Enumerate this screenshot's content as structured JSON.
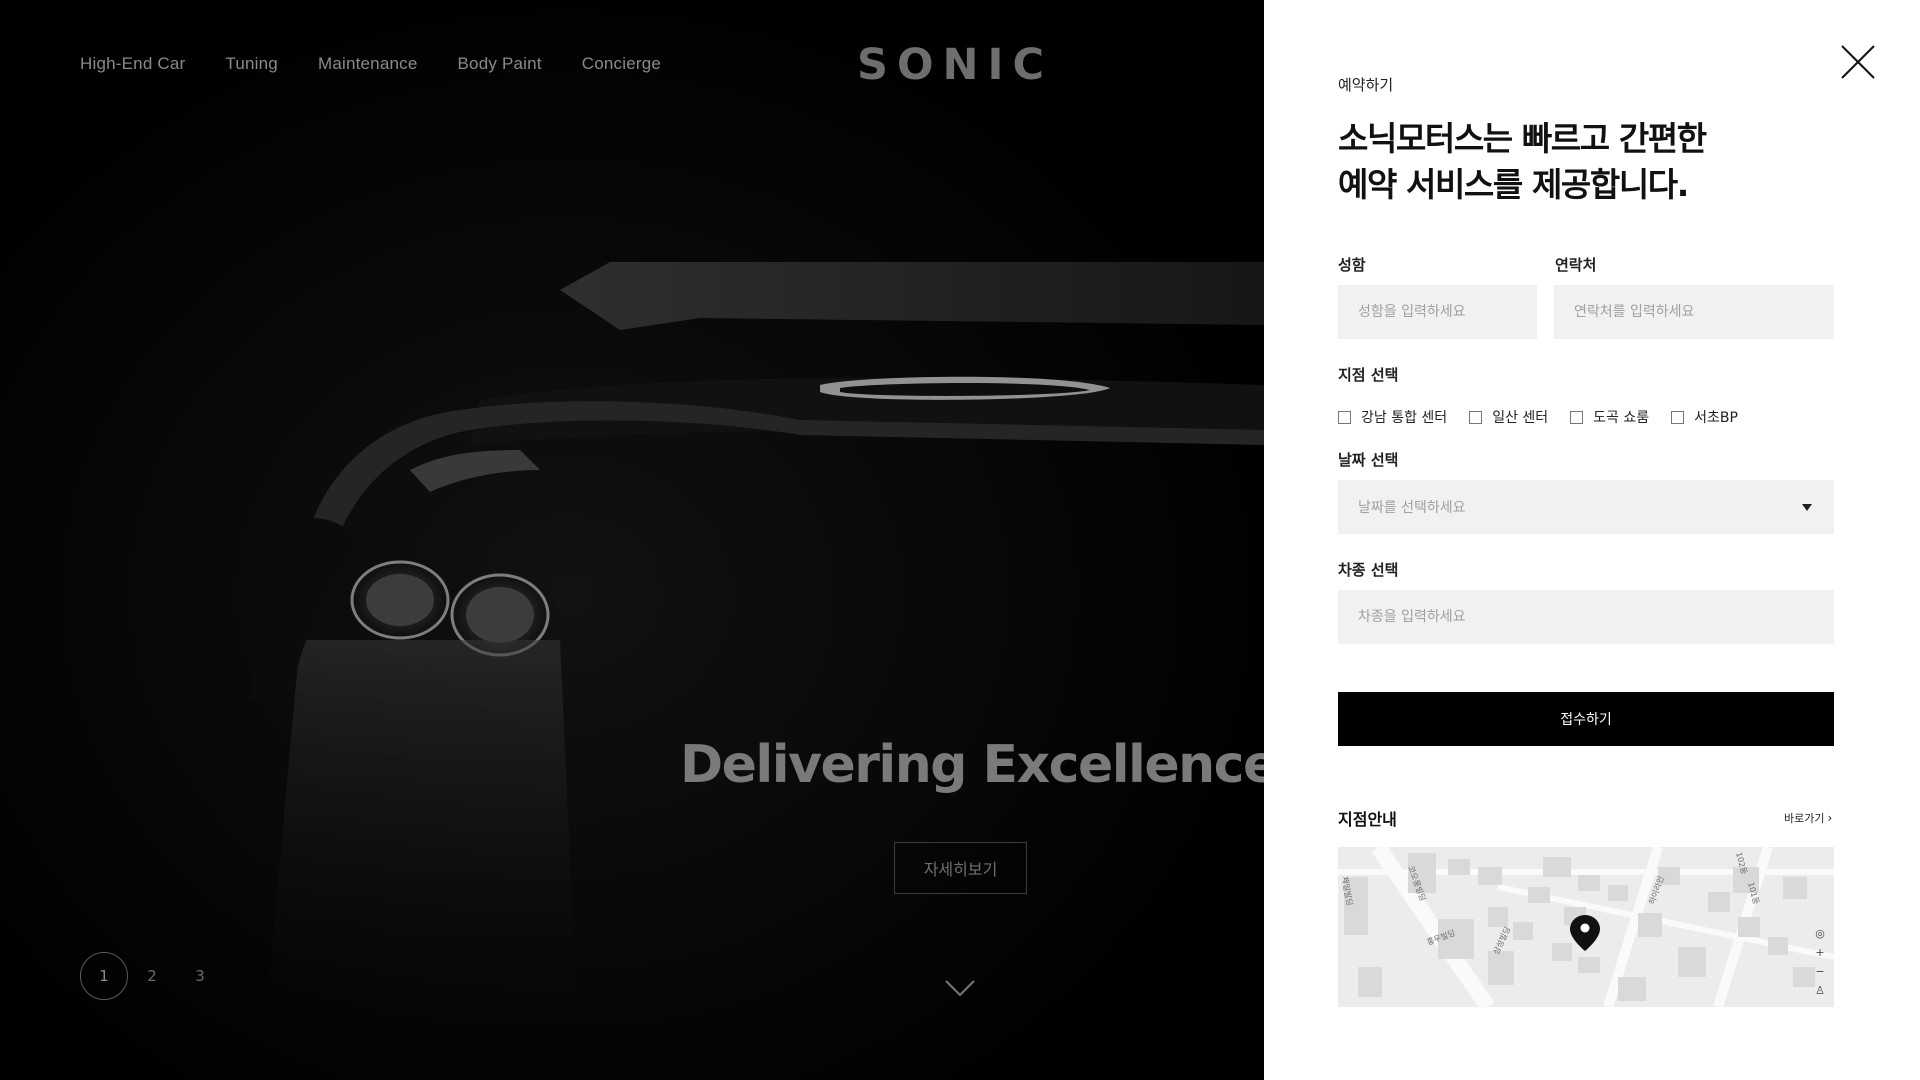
{
  "nav": {
    "items": [
      "High-End Car",
      "Tuning",
      "Maintenance",
      "Body Paint",
      "Concierge"
    ]
  },
  "brand": {
    "logo": "SONIC"
  },
  "hero": {
    "headline": "Delivering Excellence",
    "more_button": "자세히보기",
    "pager": [
      "1",
      "2",
      "3"
    ],
    "active_page": 1
  },
  "reservation": {
    "eyebrow": "예약하기",
    "title_line1": "소닉모터스는 빠르고 간편한",
    "title_line2": "예약 서비스를 제공합니다.",
    "name_label": "성함",
    "name_placeholder": "성함을 입력하세요",
    "phone_label": "연락처",
    "phone_placeholder": "연락처를 입력하세요",
    "branch_label": "지점 선택",
    "branches": [
      "강남 통합 센터",
      "일산 센터",
      "도곡 쇼룸",
      "서초BP"
    ],
    "date_label": "날짜 선택",
    "date_placeholder": "날짜를 선택하세요",
    "car_label": "차종 선택",
    "car_placeholder": "차종을 입력하세요",
    "submit_label": "접수하기"
  },
  "branch_info": {
    "title": "지점안내",
    "link": "바로가기",
    "map_controls": [
      "◎",
      "+",
      "−",
      "♙"
    ],
    "map_labels": [
      "102동",
      "101동",
      "홍우빌딩",
      "하이라인",
      "삼성빌딩",
      "코오롱빌딩",
      "제일빌딩"
    ]
  },
  "colors": {
    "panel_bg": "#ffffff",
    "input_bg": "#f1f1f1",
    "button_bg": "#000000",
    "hero_text": "#7a7a7a"
  }
}
